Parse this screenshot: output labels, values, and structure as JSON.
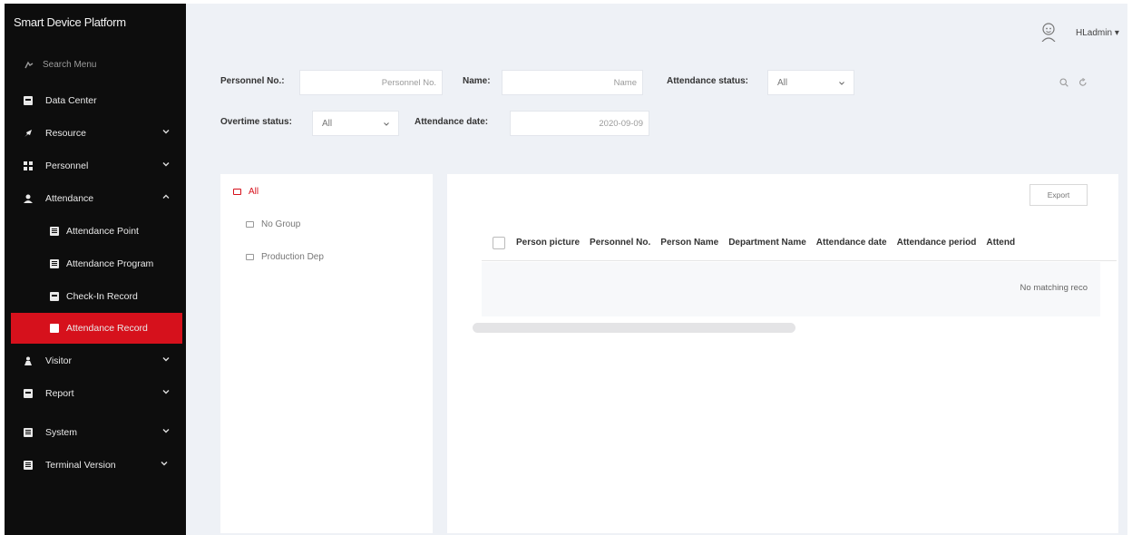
{
  "app": {
    "title": "Smart Device Platform"
  },
  "sidebar": {
    "search_label": "Search Menu",
    "items": [
      {
        "label": "Data Center",
        "icon": "monitor-icon",
        "expandable": false
      },
      {
        "label": "Resource",
        "icon": "rocket-icon",
        "expandable": true,
        "expanded": false
      },
      {
        "label": "Personnel",
        "icon": "personnel-grid-icon",
        "expandable": true,
        "expanded": false
      },
      {
        "label": "Attendance",
        "icon": "person-icon",
        "expandable": true,
        "expanded": true,
        "children": [
          {
            "label": "Attendance Point",
            "icon": "document-icon"
          },
          {
            "label": "Attendance Program",
            "icon": "document-icon"
          },
          {
            "label": "Check-In Record",
            "icon": "monitor-icon"
          },
          {
            "label": "Attendance Record",
            "icon": "monitor-icon",
            "active": true
          }
        ]
      },
      {
        "label": "Visitor",
        "icon": "visitor-icon",
        "expandable": true,
        "expanded": false
      },
      {
        "label": "Report",
        "icon": "monitor-icon",
        "expandable": true,
        "expanded": false
      },
      {
        "label": "System",
        "icon": "document-icon",
        "expandable": true,
        "expanded": false
      },
      {
        "label": "Terminal Version",
        "icon": "document-icon",
        "expandable": true,
        "expanded": false
      }
    ]
  },
  "header": {
    "user": "HLadmin",
    "avatar_icon": "avatar-icon"
  },
  "filters": {
    "personnel_no": {
      "label": "Personnel No.:",
      "placeholder": "Personnel No."
    },
    "name": {
      "label": "Name:",
      "placeholder": "Name"
    },
    "attendance_status": {
      "label": "Attendance status:",
      "value": "All"
    },
    "overtime_status": {
      "label": "Overtime status:",
      "value": "All"
    },
    "attendance_date": {
      "label": "Attendance date:",
      "value": "2020-09-09"
    },
    "search_icon": "search-icon",
    "reset_icon": "refresh-icon"
  },
  "tree": {
    "root": "All",
    "children": [
      "No Group",
      "Production Dep"
    ]
  },
  "table": {
    "export_label": "Export",
    "columns": [
      "Person picture",
      "Personnel No.",
      "Person Name",
      "Department Name",
      "Attendance date",
      "Attendance period",
      "Attend"
    ],
    "empty_text": "No matching reco"
  },
  "colors": {
    "accent": "#d6111c",
    "sidebar_bg": "#0d0d0d",
    "main_bg": "#eef1f6"
  }
}
